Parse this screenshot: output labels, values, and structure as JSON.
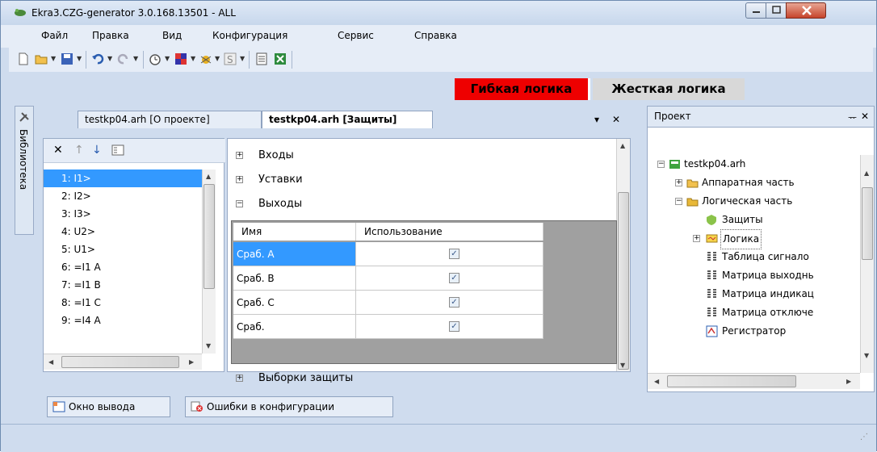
{
  "window": {
    "title": "Ekra3.CZG-generator 3.0.168.13501 - ALL"
  },
  "menu": [
    "Файл",
    "Правка",
    "Вид",
    "Конфигурация",
    "Сервис",
    "Справка"
  ],
  "toolbar": {
    "flex_logic": "Гибкая логика",
    "hard_logic": "Жесткая логика",
    "flex_color": "#ee0000"
  },
  "library": {
    "label": "Библиотека"
  },
  "tabs": [
    {
      "label": "testkp04.arh [О проекте]",
      "active": false
    },
    {
      "label": "testkp04.arh [Защиты]",
      "active": true
    }
  ],
  "list": {
    "items": [
      "1: I1>",
      "2: I2>",
      "3: I3>",
      "4: U2>",
      "5: U1>",
      "6: =I1 A",
      "7: =I1 B",
      "8: =I1 C",
      "9: =I4 A"
    ],
    "selected_index": 0
  },
  "properties": {
    "sections": [
      {
        "label": "Входы",
        "expanded": false
      },
      {
        "label": "Уставки",
        "expanded": false
      },
      {
        "label": "Выходы",
        "expanded": true
      },
      {
        "label": "Выборки защиты",
        "expanded": false
      }
    ],
    "grid": {
      "headers": [
        "Имя",
        "Использование"
      ],
      "rows": [
        {
          "name": "Сраб. А",
          "checked": true
        },
        {
          "name": "Сраб. В",
          "checked": true
        },
        {
          "name": "Сраб. С",
          "checked": true
        },
        {
          "name": "Сраб.",
          "checked": true
        }
      ]
    }
  },
  "project": {
    "title": "Проект",
    "pin": "ᅲ",
    "close": "✕",
    "tree": [
      {
        "label": "testkp04.arh",
        "level": 0,
        "icon": "project-icon"
      },
      {
        "label": "Аппаратная часть",
        "level": 1,
        "icon": "folder-icon"
      },
      {
        "label": "Логическая часть",
        "level": 1,
        "icon": "folder-icon"
      },
      {
        "label": "Защиты",
        "level": 2,
        "icon": "shield-icon"
      },
      {
        "label": "Логика",
        "level": 2,
        "icon": "logic-icon",
        "selected": true
      },
      {
        "label": "Таблица сигнало",
        "level": 2,
        "icon": "table-icon"
      },
      {
        "label": "Матрица выходнь",
        "level": 2,
        "icon": "matrix-icon"
      },
      {
        "label": "Матрица индикац",
        "level": 2,
        "icon": "matrix-icon"
      },
      {
        "label": "Матрица отключе",
        "level": 2,
        "icon": "matrix-icon"
      },
      {
        "label": "Регистратор",
        "level": 2,
        "icon": "recorder-icon"
      }
    ]
  },
  "bottom_tabs": [
    "Окно вывода",
    "Ошибки в конфигурации"
  ]
}
